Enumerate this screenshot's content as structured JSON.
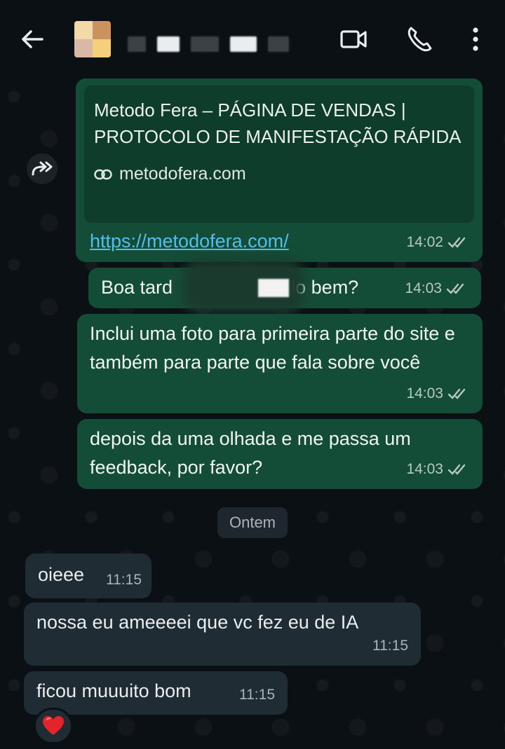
{
  "header": {
    "back_icon": "arrow-left-icon",
    "video_icon": "video-camera-icon",
    "call_icon": "phone-icon",
    "menu_icon": "vertical-dots-icon"
  },
  "messages": {
    "link": {
      "preview_title": "Metodo Fera – PÁGINA DE VENDAS | PROTOCOLO DE MANIFESTAÇÃO RÁPIDA",
      "preview_domain": "metodofera.com",
      "url": "https://metodofera.com/",
      "time": "14:02"
    },
    "m2": {
      "text_start": "Boa tard",
      "text_end": "udo bem?",
      "time": "14:03"
    },
    "m3": {
      "text": "Inclui uma foto para primeira parte do site e também para parte que fala sobre você",
      "time": "14:03"
    },
    "m4": {
      "text": "depois da uma olhada e me passa um feedback, por favor?",
      "time": "14:03"
    },
    "date_divider": "Ontem",
    "m5": {
      "text": "oieee",
      "time": "11:15"
    },
    "m6": {
      "text": "nossa eu ameeeei que vc fez eu de IA",
      "time": "11:15"
    },
    "m7": {
      "text": "ficou muuuito bom",
      "time": "11:15"
    },
    "reaction": "❤️"
  },
  "colors": {
    "outgoing": "#144d37",
    "incoming": "#1f2c34",
    "link": "#53bdeb",
    "background": "#0b1014"
  }
}
